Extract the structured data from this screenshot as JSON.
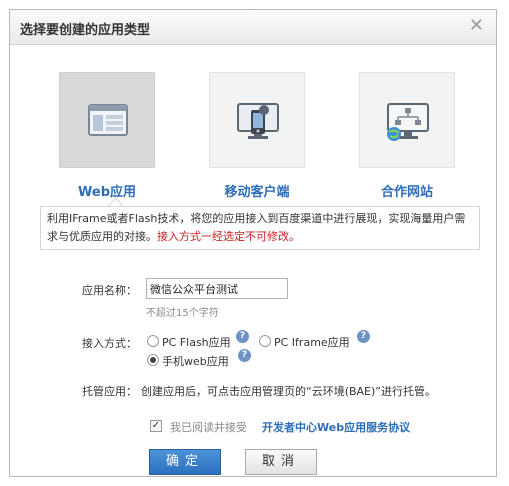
{
  "dialog": {
    "title": "选择要创建的应用类型",
    "close_icon": "close-icon"
  },
  "app_types": [
    {
      "label": "Web应用",
      "icon": "web-window-icon",
      "selected": true
    },
    {
      "label": "移动客户端",
      "icon": "mobile-monitor-icon",
      "selected": false
    },
    {
      "label": "合作网站",
      "icon": "network-site-icon",
      "selected": false
    }
  ],
  "description": {
    "text": "利用IFrame或者Flash技术，将您的应用接入到百度渠道中进行展现，实现海量用户需求与优质应用的对接。",
    "warning": "接入方式一经选定不可修改。"
  },
  "form": {
    "name_label": "应用名称：",
    "name_value": "微信公众平台测试",
    "name_hint": "不超过15个字符",
    "access_label": "接入方式：",
    "access_options": [
      {
        "label": "PC Flash应用",
        "checked": false
      },
      {
        "label": "PC Iframe应用",
        "checked": false
      },
      {
        "label": "手机web应用",
        "checked": true
      }
    ],
    "hosting_label": "托管应用：",
    "hosting_text": "创建应用后，可点击应用管理页的“云环境(BAE)”进行托管。"
  },
  "agreement": {
    "checked": true,
    "text": "我已阅读并接受",
    "link": "开发者中心Web应用服务协议"
  },
  "buttons": {
    "ok": "确定",
    "cancel": "取消"
  },
  "colors": {
    "link_blue": "#2d6db8",
    "warning_red": "#cc1f1f",
    "primary_button": "#2b70be"
  }
}
